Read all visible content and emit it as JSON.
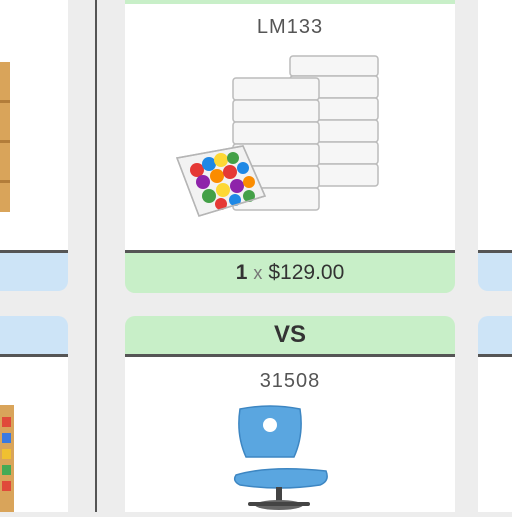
{
  "compare": {
    "item1": {
      "sku": "LM133",
      "image_icon": "clear-storage-bins-icon",
      "price": {
        "qty": "1",
        "times": "x",
        "amount": "$129.00"
      }
    },
    "vs_label": "VS",
    "item2": {
      "sku": "31508",
      "image_icon": "blue-task-chair-icon"
    }
  },
  "colors": {
    "accent_green": "#c8efc8",
    "side_blue": "#cde4f7",
    "divider": "#555555",
    "background": "#ededed"
  }
}
